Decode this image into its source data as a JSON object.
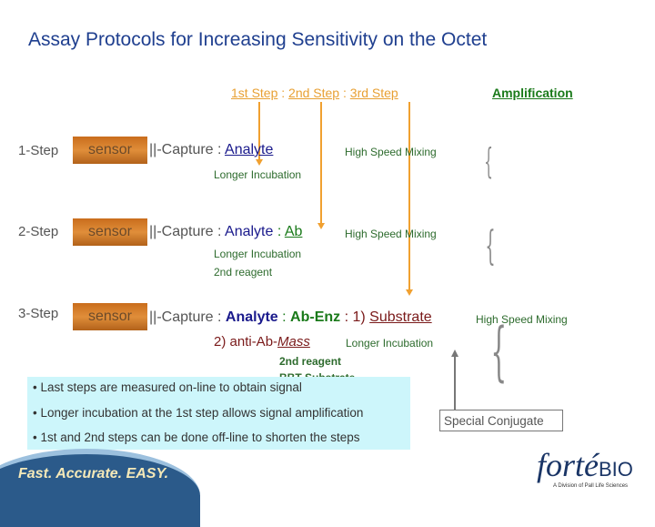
{
  "title": "Assay Protocols for Increasing Sensitivity on the Octet",
  "header": {
    "step1": "1st Step",
    "step2": "2nd Step",
    "step3": "3rd Step",
    "sep": ":",
    "amplification": "Amplification"
  },
  "rows": [
    {
      "label": "1-Step",
      "sensor": "sensor",
      "capture": "||-Capture : ",
      "analyte": "Analyte",
      "mixing": "High Speed Mixing",
      "incubation": "Longer Incubation"
    },
    {
      "label": "2-Step",
      "sensor": "sensor",
      "capture": "||-Capture : ",
      "analyte": "Analyte",
      "sep": " : ",
      "ab": "Ab",
      "mixing": "High Speed Mixing",
      "incubation": "Longer Incubation",
      "reagent": "2nd reagent"
    },
    {
      "label": "3-Step",
      "sensor": "sensor",
      "capture": "||-Capture : ",
      "analyte": "Analyte",
      "sep": " : ",
      "abenz": "Ab-Enz",
      "sep2": " : 1) ",
      "substrate": "Substrate",
      "mixing": "High Speed Mixing",
      "alt_prefix": "2) anti-Ab-",
      "alt_mass": "Mass",
      "incubation": "Longer Incubation",
      "reagent": "2nd reagent",
      "substrate2": "BBT Substrate"
    }
  ],
  "notes": [
    "• Last steps are measured on-line to obtain signal",
    "• Longer incubation at the 1st step allows signal amplification",
    "• 1st and 2nd steps can be done off-line to shorten the steps"
  ],
  "special_conjugate": "Special Conjugate",
  "footer": {
    "tagline": "Fast. Accurate. EASY.",
    "logo": "fortéBIO",
    "logo_sub": "A Division of Pall Life Sciences"
  },
  "colors": {
    "title": "#1f3f8f",
    "step": "#f0a030",
    "green": "#1a7a1a",
    "note_bg": "#cdf6fb"
  }
}
